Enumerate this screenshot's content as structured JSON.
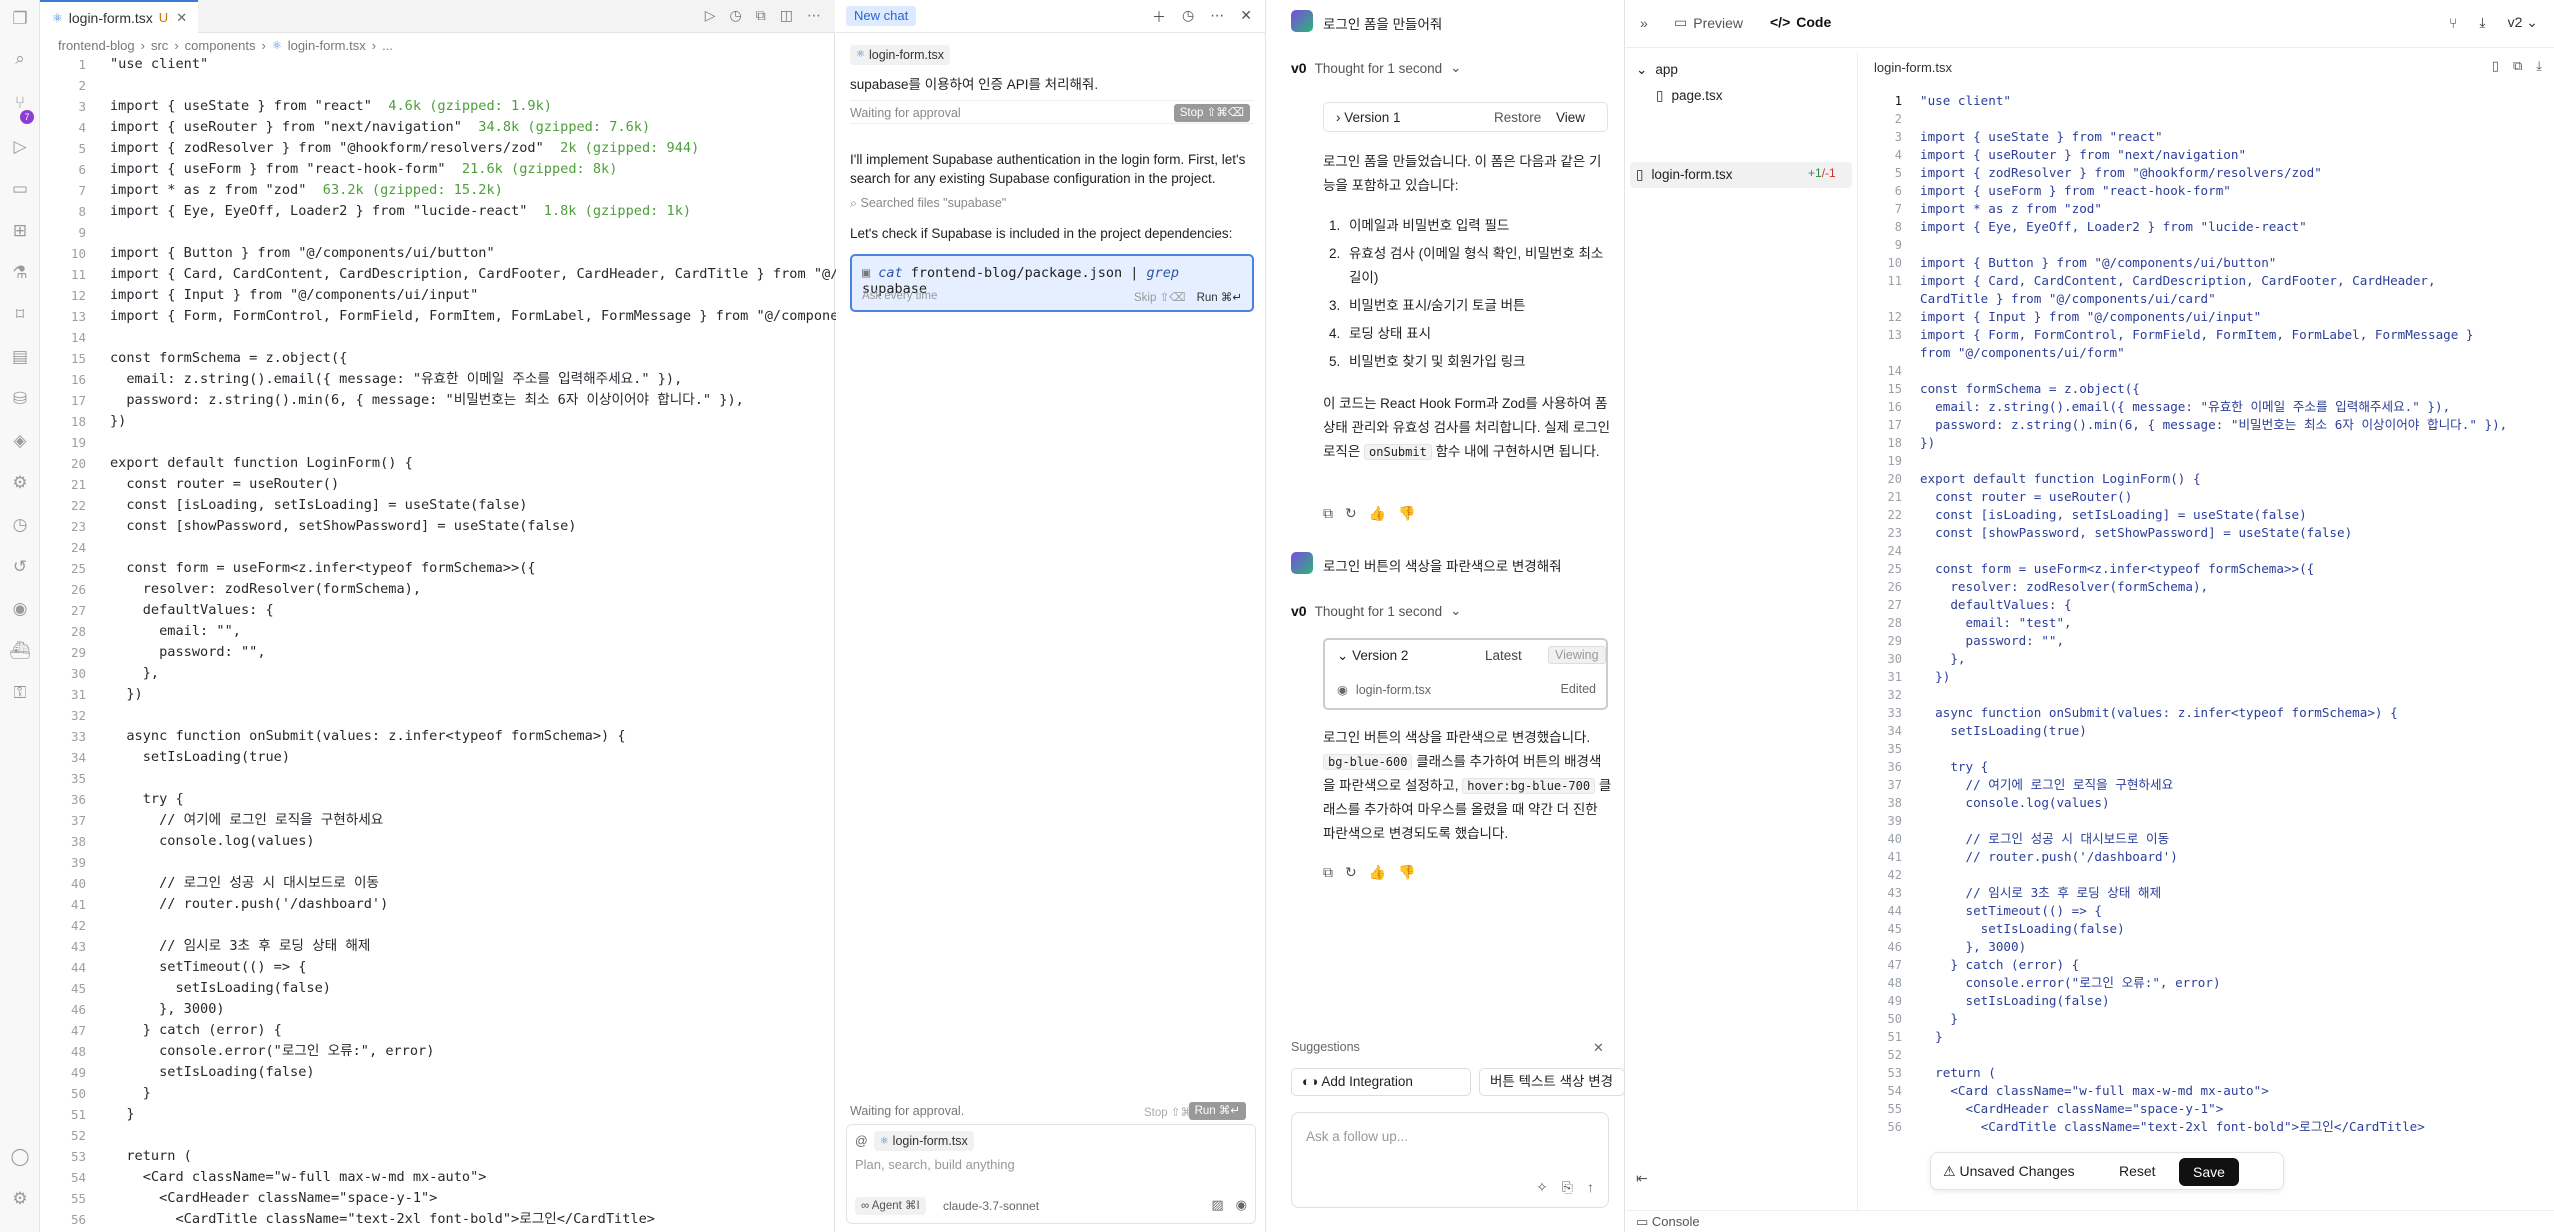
{
  "activity_bar": {
    "badge": "7"
  },
  "editor": {
    "tab_label": "login-form.tsx",
    "tab_modified": "U",
    "breadcrumb": [
      "frontend-blog",
      "src",
      "components",
      "login-form.tsx",
      "..."
    ],
    "lines": [
      {
        "n": "1",
        "t": "\"use client\""
      },
      {
        "n": "2",
        "t": ""
      },
      {
        "n": "3",
        "t": "import { useState } from \"react\"",
        "s": "  4.6k (gzipped: 1.9k)"
      },
      {
        "n": "4",
        "t": "import { useRouter } from \"next/navigation\"",
        "s": "  34.8k (gzipped: 7.6k)"
      },
      {
        "n": "5",
        "t": "import { zodResolver } from \"@hookform/resolvers/zod\"",
        "s": "  2k (gzipped: 944)"
      },
      {
        "n": "6",
        "t": "import { useForm } from \"react-hook-form\"",
        "s": "  21.6k (gzipped: 8k)"
      },
      {
        "n": "7",
        "t": "import * as z from \"zod\"",
        "s": "  63.2k (gzipped: 15.2k)"
      },
      {
        "n": "8",
        "t": "import { Eye, EyeOff, Loader2 } from \"lucide-react\"",
        "s": "  1.8k (gzipped: 1k)"
      },
      {
        "n": "9",
        "t": ""
      },
      {
        "n": "10",
        "t": "import { Button } from \"@/components/ui/button\""
      },
      {
        "n": "11",
        "t": "import { Card, CardContent, CardDescription, CardFooter, CardHeader, CardTitle } from \"@/components/ui/"
      },
      {
        "n": "12",
        "t": "import { Input } from \"@/components/ui/input\""
      },
      {
        "n": "13",
        "t": "import { Form, FormControl, FormField, FormItem, FormLabel, FormMessage } from \"@/components/ui/form\""
      },
      {
        "n": "14",
        "t": ""
      },
      {
        "n": "15",
        "t": "const formSchema = z.object({"
      },
      {
        "n": "16",
        "t": "  email: z.string().email({ message: \"유효한 이메일 주소를 입력해주세요.\" }),"
      },
      {
        "n": "17",
        "t": "  password: z.string().min(6, { message: \"비밀번호는 최소 6자 이상이어야 합니다.\" }),"
      },
      {
        "n": "18",
        "t": "})"
      },
      {
        "n": "19",
        "t": ""
      },
      {
        "n": "20",
        "t": "export default function LoginForm() {"
      },
      {
        "n": "21",
        "t": "  const router = useRouter()"
      },
      {
        "n": "22",
        "t": "  const [isLoading, setIsLoading] = useState(false)"
      },
      {
        "n": "23",
        "t": "  const [showPassword, setShowPassword] = useState(false)"
      },
      {
        "n": "24",
        "t": ""
      },
      {
        "n": "25",
        "t": "  const form = useForm<z.infer<typeof formSchema>>({"
      },
      {
        "n": "26",
        "t": "    resolver: zodResolver(formSchema),"
      },
      {
        "n": "27",
        "t": "    defaultValues: {"
      },
      {
        "n": "28",
        "t": "      email: \"\","
      },
      {
        "n": "29",
        "t": "      password: \"\","
      },
      {
        "n": "30",
        "t": "    },"
      },
      {
        "n": "31",
        "t": "  })"
      },
      {
        "n": "32",
        "t": ""
      },
      {
        "n": "33",
        "t": "  async function onSubmit(values: z.infer<typeof formSchema>) {"
      },
      {
        "n": "34",
        "t": "    setIsLoading(true)"
      },
      {
        "n": "35",
        "t": ""
      },
      {
        "n": "36",
        "t": "    try {"
      },
      {
        "n": "37",
        "t": "      // 여기에 로그인 로직을 구현하세요"
      },
      {
        "n": "38",
        "t": "      console.log(values)"
      },
      {
        "n": "39",
        "t": ""
      },
      {
        "n": "40",
        "t": "      // 로그인 성공 시 대시보드로 이동"
      },
      {
        "n": "41",
        "t": "      // router.push('/dashboard')"
      },
      {
        "n": "42",
        "t": ""
      },
      {
        "n": "43",
        "t": "      // 임시로 3초 후 로딩 상태 해제"
      },
      {
        "n": "44",
        "t": "      setTimeout(() => {"
      },
      {
        "n": "45",
        "t": "        setIsLoading(false)"
      },
      {
        "n": "46",
        "t": "      }, 3000)"
      },
      {
        "n": "47",
        "t": "    } catch (error) {"
      },
      {
        "n": "48",
        "t": "      console.error(\"로그인 오류:\", error)"
      },
      {
        "n": "49",
        "t": "      setIsLoading(false)"
      },
      {
        "n": "50",
        "t": "    }"
      },
      {
        "n": "51",
        "t": "  }"
      },
      {
        "n": "52",
        "t": ""
      },
      {
        "n": "53",
        "t": "  return ("
      },
      {
        "n": "54",
        "t": "    <Card className=\"w-full max-w-md mx-auto\">"
      },
      {
        "n": "55",
        "t": "      <CardHeader className=\"space-y-1\">"
      },
      {
        "n": "56",
        "t": "        <CardTitle className=\"text-2xl font-bold\">로그인</CardTitle>"
      }
    ]
  },
  "chat": {
    "new_chat": "New chat",
    "context_file": "login-form.tsx",
    "query": "supabase를 이용하여 인증 API를 처리해줘.",
    "waiting": "Waiting for approval",
    "stop": "Stop ⇧⌘⌫",
    "response1": "I'll implement Supabase authentication in the login form. First, let's search for any existing Supabase configuration in the project.",
    "searched": "Searched files \"supabase\"",
    "response2": "Let's check if Supabase is included in the project dependencies:",
    "cmd_cat": "cat",
    "cmd_path": "frontend-blog/package.json",
    "cmd_pipe": "|",
    "cmd_grep": "grep",
    "cmd_arg": "supabase",
    "cmd_ask": "Ask every time",
    "cmd_skip": "Skip ⇧⌫",
    "cmd_run": "Run ⌘↵",
    "waiting2": "Waiting for approval.",
    "stop2": "Stop ⇧⌘⌫",
    "run2": "Run ⌘↵",
    "composer_ctx": "login-form.tsx",
    "composer_placeholder": "Plan, search, build anything",
    "agent": "∞ Agent ⌘I",
    "model": "claude-3.7-sonnet"
  },
  "conversation": {
    "user1": "로그인 폼을 만들어줘",
    "thought": "Thought for 1 second",
    "version1": "Version 1",
    "restore": "Restore",
    "view": "View",
    "intro1": "로그인 폼을 만들었습니다. 이 폼은 다음과 같은 기능을 포함하고 있습니다:",
    "features": [
      "이메일과 비밀번호 입력 필드",
      "유효성 검사 (이메일 형식 확인, 비밀번호 최소 길이)",
      "비밀번호 표시/숨기기 토글 버튼",
      "로딩 상태 표시",
      "비밀번호 찾기 및 회원가입 링크"
    ],
    "outro1_a": "이 코드는 React Hook Form과 Zod를 사용하여 폼 상태 관리와 유효성 검사를 처리합니다. 실제 로그인 로직은",
    "outro1_code": "onSubmit",
    "outro1_b": "함수 내에 구현하시면 됩니다.",
    "user2": "로그인 버튼의 색상을 파란색으로 변경해줘",
    "version2": "Version 2",
    "latest": "Latest",
    "viewing": "Viewing",
    "v2_file": "login-form.tsx",
    "v2_status": "Edited",
    "ans2_a": "로그인 버튼의 색상을 파란색으로 변경했습니다.",
    "ans2_code1": "bg-blue-600",
    "ans2_b": "클래스를 추가하여 버튼의 배경색을 파란색으로 설정하고,",
    "ans2_code2": "hover:bg-blue-700",
    "ans2_c": "클래스를 추가하여 마우스를 올렸을 때 약간 더 진한 파란색으로 변경되도록 했습니다.",
    "suggestions_label": "Suggestions",
    "sugg1": "Add Integration",
    "sugg2": "버튼 텍스트 색상 변경",
    "followup_placeholder": "Ask a follow up..."
  },
  "files": {
    "preview_tab": "Preview",
    "code_tab": "Code",
    "version": "v2",
    "tree": {
      "folder": "app",
      "page": "page.tsx",
      "file": "login-form.tsx",
      "added": "+1",
      "removed": "/-1"
    },
    "current_file": "login-form.tsx",
    "code_lines": [
      {
        "n": "1",
        "t": "\"use client\""
      },
      {
        "n": "2",
        "t": ""
      },
      {
        "n": "3",
        "t": "import { useState } from \"react\""
      },
      {
        "n": "4",
        "t": "import { useRouter } from \"next/navigation\""
      },
      {
        "n": "5",
        "t": "import { zodResolver } from \"@hookform/resolvers/zod\""
      },
      {
        "n": "6",
        "t": "import { useForm } from \"react-hook-form\""
      },
      {
        "n": "7",
        "t": "import * as z from \"zod\""
      },
      {
        "n": "8",
        "t": "import { Eye, EyeOff, Loader2 } from \"lucide-react\""
      },
      {
        "n": "9",
        "t": ""
      },
      {
        "n": "10",
        "t": "import { Button } from \"@/components/ui/button\""
      },
      {
        "n": "11",
        "t": "import { Card, CardContent, CardDescription, CardFooter, CardHeader,"
      },
      {
        "n": "",
        "t": "CardTitle } from \"@/components/ui/card\""
      },
      {
        "n": "12",
        "t": "import { Input } from \"@/components/ui/input\""
      },
      {
        "n": "13",
        "t": "import { Form, FormControl, FormField, FormItem, FormLabel, FormMessage }"
      },
      {
        "n": "",
        "t": "from \"@/components/ui/form\""
      },
      {
        "n": "14",
        "t": ""
      },
      {
        "n": "15",
        "t": "const formSchema = z.object({"
      },
      {
        "n": "16",
        "t": "  email: z.string().email({ message: \"유효한 이메일 주소를 입력해주세요.\" }),"
      },
      {
        "n": "17",
        "t": "  password: z.string().min(6, { message: \"비밀번호는 최소 6자 이상이어야 합니다.\" }),"
      },
      {
        "n": "18",
        "t": "})"
      },
      {
        "n": "19",
        "t": ""
      },
      {
        "n": "20",
        "t": "export default function LoginForm() {"
      },
      {
        "n": "21",
        "t": "  const router = useRouter()"
      },
      {
        "n": "22",
        "t": "  const [isLoading, setIsLoading] = useState(false)"
      },
      {
        "n": "23",
        "t": "  const [showPassword, setShowPassword] = useState(false)"
      },
      {
        "n": "24",
        "t": ""
      },
      {
        "n": "25",
        "t": "  const form = useForm<z.infer<typeof formSchema>>({"
      },
      {
        "n": "26",
        "t": "    resolver: zodResolver(formSchema),"
      },
      {
        "n": "27",
        "t": "    defaultValues: {"
      },
      {
        "n": "28",
        "t": "      email: \"test\","
      },
      {
        "n": "29",
        "t": "      password: \"\","
      },
      {
        "n": "30",
        "t": "    },"
      },
      {
        "n": "31",
        "t": "  })"
      },
      {
        "n": "32",
        "t": ""
      },
      {
        "n": "33",
        "t": "  async function onSubmit(values: z.infer<typeof formSchema>) {"
      },
      {
        "n": "34",
        "t": "    setIsLoading(true)"
      },
      {
        "n": "35",
        "t": ""
      },
      {
        "n": "36",
        "t": "    try {"
      },
      {
        "n": "37",
        "t": "      // 여기에 로그인 로직을 구현하세요"
      },
      {
        "n": "38",
        "t": "      console.log(values)"
      },
      {
        "n": "39",
        "t": ""
      },
      {
        "n": "40",
        "t": "      // 로그인 성공 시 대시보드로 이동"
      },
      {
        "n": "41",
        "t": "      // router.push('/dashboard')"
      },
      {
        "n": "42",
        "t": ""
      },
      {
        "n": "43",
        "t": "      // 임시로 3초 후 로딩 상태 해제"
      },
      {
        "n": "44",
        "t": "      setTimeout(() => {"
      },
      {
        "n": "45",
        "t": "        setIsLoading(false)"
      },
      {
        "n": "46",
        "t": "      }, 3000)"
      },
      {
        "n": "47",
        "t": "    } catch (error) {"
      },
      {
        "n": "48",
        "t": "      console.error(\"로그인 오류:\", error)"
      },
      {
        "n": "49",
        "t": "      setIsLoading(false)"
      },
      {
        "n": "50",
        "t": "    }"
      },
      {
        "n": "51",
        "t": "  }"
      },
      {
        "n": "52",
        "t": ""
      },
      {
        "n": "53",
        "t": "  return ("
      },
      {
        "n": "54",
        "t": "    <Card className=\"w-full max-w-md mx-auto\">"
      },
      {
        "n": "55",
        "t": "      <CardHeader className=\"space-y-1\">"
      },
      {
        "n": "56",
        "t": "        <CardTitle className=\"text-2xl font-bold\">로그인</CardTitle>"
      }
    ],
    "unsaved": "Unsaved Changes",
    "reset": "Reset",
    "save": "Save",
    "console": "Console"
  }
}
